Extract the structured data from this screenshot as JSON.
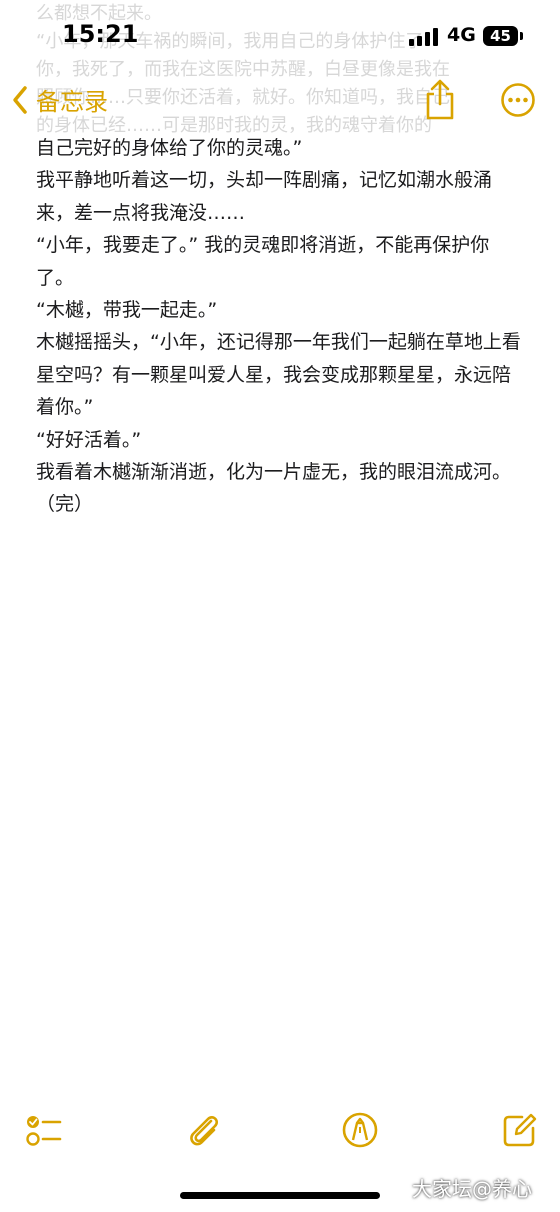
{
  "status_bar": {
    "time": "15:21",
    "network": "4G",
    "battery": "45"
  },
  "nav": {
    "back_label": "备忘录",
    "accent": "#d9a300",
    "share_icon": "share-icon",
    "more_icon": "ellipsis-circle-icon"
  },
  "faded_lines": [
    "么都想不起来。",
    "“小年，那天车祸的瞬间，我用自己的身体护住了",
    "你，我死了，而我在这医院中苏醒，白昼更像是我在",
    "照顾你……只要你还活着，就好。你知道吗，我自己",
    "的身体已经……可是那时我的灵，我的魂守着你的"
  ],
  "note": {
    "paragraphs": [
      "自己完好的身体给了你的灵魂。”",
      "我平静地听着这一切，头却一阵剧痛，记忆如潮水般涌来，差一点将我淹没……",
      "“小年，我要走了。” 我的灵魂即将消逝，不能再保护你了。",
      "“木樾，带我一起走。”",
      "木樾摇摇头，“小年，还记得那一年我们一起躺在草地上看星空吗？有一颗星叫爱人星，我会变成那颗星星，永远陪着你。”",
      "“好好活着。”",
      "我看着木樾渐渐消逝，化为一片虚无，我的眼泪流成河。（完）"
    ]
  },
  "toolbar": {
    "checklist_icon": "checklist-icon",
    "attachment_icon": "paperclip-icon",
    "markup_icon": "pen-markup-icon",
    "compose_icon": "compose-icon"
  },
  "watermark": "大家坛@养心"
}
